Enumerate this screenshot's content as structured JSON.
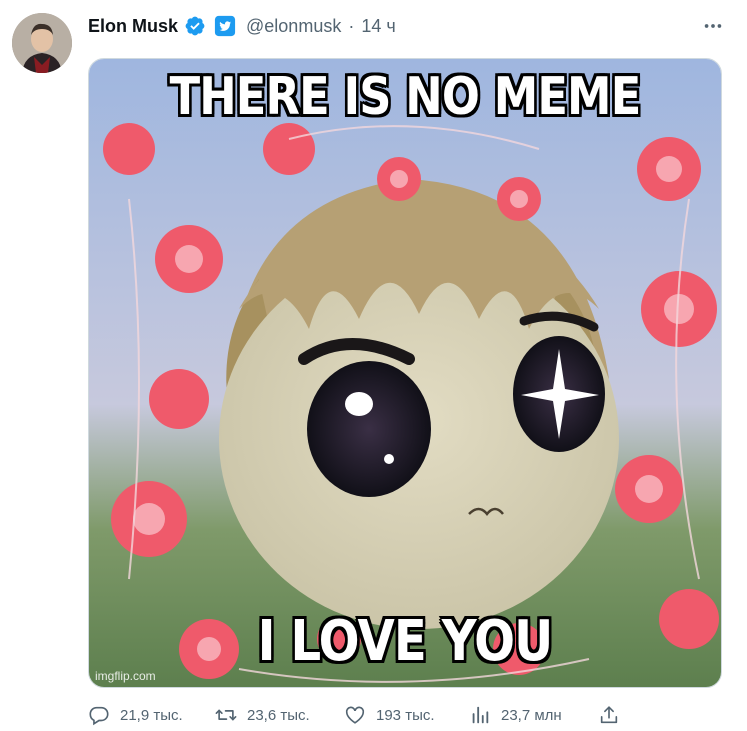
{
  "author": {
    "name": "Elon Musk",
    "handle": "@elonmusk",
    "separator": "·",
    "time": "14 ч",
    "verified_icon": "verified-badge-icon",
    "affiliation_icon": "twitter-bird-badge-icon"
  },
  "media": {
    "top_caption": "THERE IS NO MEME",
    "bottom_caption": "I LOVE YOU",
    "watermark": "imgflip.com"
  },
  "actions": {
    "replies": "21,9 тыс.",
    "retweets": "23,6 тыс.",
    "likes": "193 тыс.",
    "views": "23,7 млн"
  },
  "colors": {
    "accent": "#1d9bf0",
    "secondary_text": "#536471",
    "primary_text": "#0f1419"
  }
}
